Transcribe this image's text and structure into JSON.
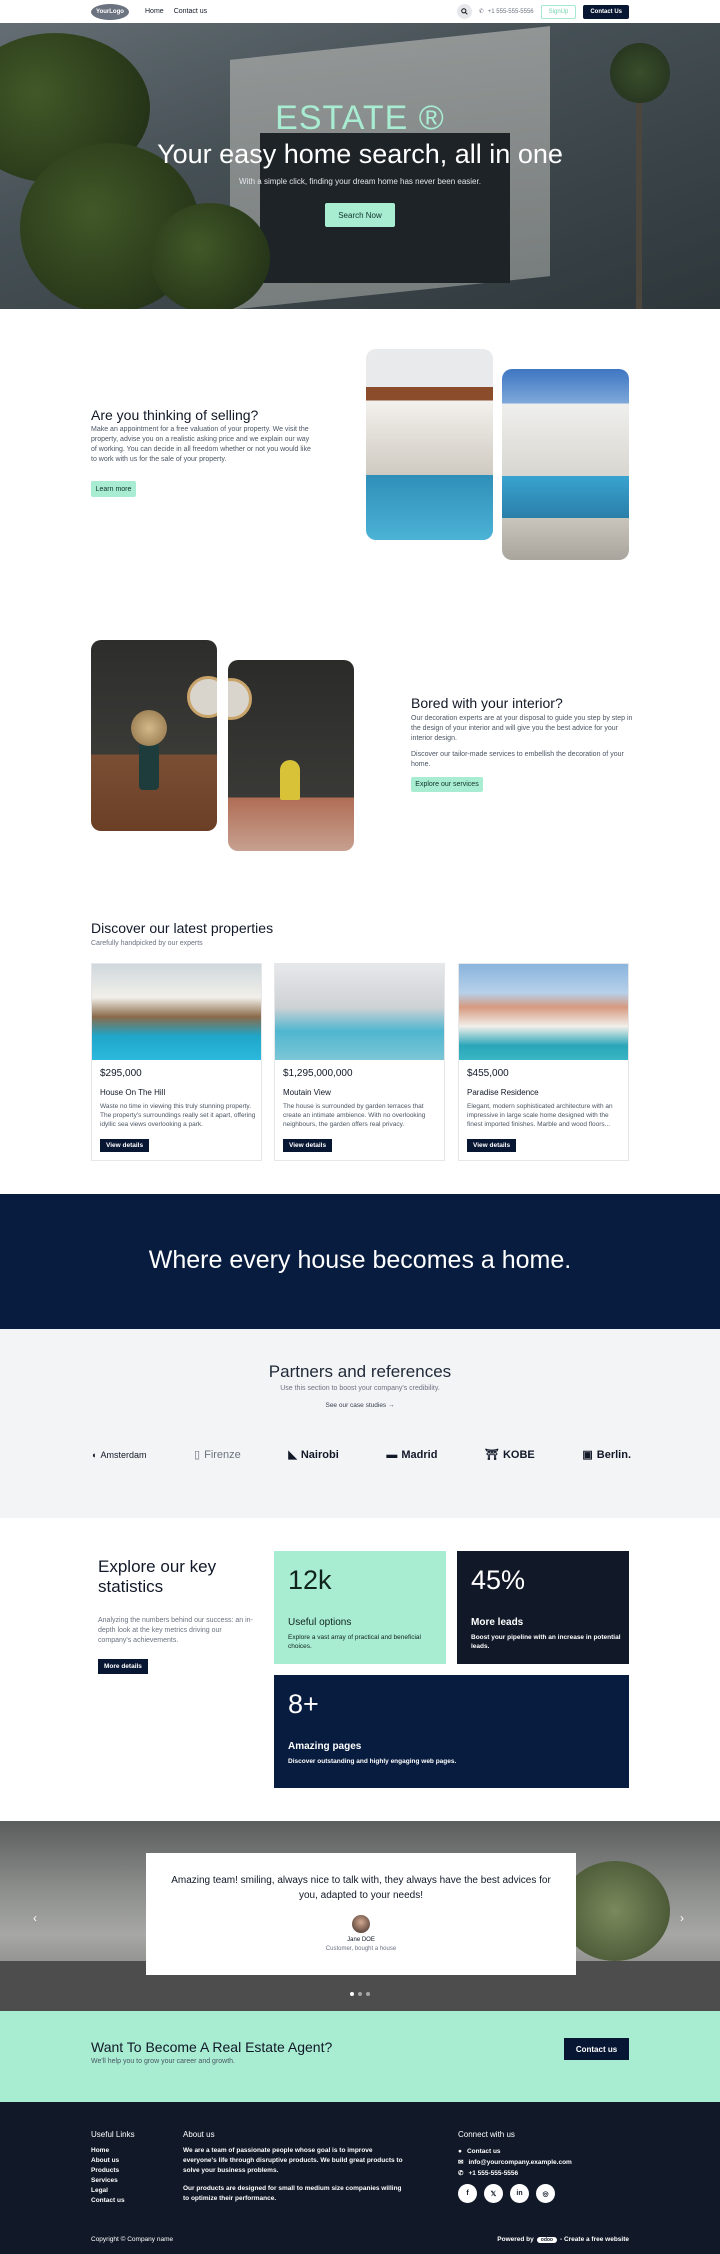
{
  "nav": {
    "logo": "YourLogo",
    "links": [
      "Home",
      "Contact us"
    ],
    "phone": "+1 555-555-5556",
    "signup": "SignUp",
    "contact": "Contact Us"
  },
  "hero": {
    "brand": "ESTATE ®",
    "title": "Your easy home search, all in one",
    "subtitle": "With a simple click, finding your dream home has never been easier.",
    "button": "Search Now"
  },
  "sell": {
    "title": "Are you thinking of selling?",
    "text": "Make an appointment for a free valuation of your property. We visit the property, advise you on a realistic asking price and we explain our way of working. You can decide in all freedom whether or not you would like to work with us for the sale of your property.",
    "button": "Learn more"
  },
  "interior": {
    "title": "Bored with your interior?",
    "text1": "Our decoration experts are at your disposal to guide you step by step in the design of your interior and will give you the best advice for your interior design.",
    "text2": "Discover our tailor-made services to embellish the decoration of your home.",
    "button": "Explore our services"
  },
  "properties": {
    "title": "Discover our latest properties",
    "subtitle": "Carefully handpicked by our experts",
    "button": "View details",
    "items": [
      {
        "price": "$295,000",
        "name": "House On The Hill",
        "desc": "Waste no time in viewing this truly stunning property. The property's surroundings really set it apart, offering idyllic sea views overlooking a park."
      },
      {
        "price": "$1,295,000,000",
        "name": "Moutain View",
        "desc": "The house is surrounded by garden terraces that create an intimate ambience. With no overlooking neighbours, the garden offers real privacy."
      },
      {
        "price": "$455,000",
        "name": "Paradise Residence",
        "desc": "Elegant, modern sophisticated architecture with an impressive in large scale home designed with the finest imported finishes. Marble and wood floors..."
      }
    ]
  },
  "banner": {
    "text": "Where every house becomes a home."
  },
  "partners": {
    "title": "Partners and references",
    "subtitle": "Use this section to boost your company's credibility.",
    "link": "See our case studies  →",
    "logos": [
      "Amsterdam",
      "Firenze",
      "Nairobi",
      "Madrid",
      "KOBE",
      "Berlin."
    ]
  },
  "stats": {
    "title": "Explore our key statistics",
    "text": "Analyzing the numbers behind our success: an in-depth look at the key metrics driving our company's achievements.",
    "button": "More details",
    "items": [
      {
        "value": "12k",
        "label": "Useful options",
        "text": "Explore a vast array of practical and beneficial choices."
      },
      {
        "value": "45%",
        "label": "More leads",
        "text": "Boost your pipeline with an increase in potential leads."
      },
      {
        "value": "8+",
        "label": "Amazing pages",
        "text": "Discover outstanding and highly engaging web pages."
      }
    ]
  },
  "testimonial": {
    "quote": "Amazing team! smiling, always nice to talk with, they always have the best advices for you, adapted to your needs!",
    "name": "Jane DOE",
    "role": "Customer, bought a house"
  },
  "cta": {
    "title": "Want To Become A Real Estate Agent?",
    "subtitle": "We'll help you to grow your career and growth.",
    "button": "Contact us"
  },
  "footer": {
    "useful_title": "Useful Links",
    "links": [
      "Home",
      "About us",
      "Products",
      "Services",
      "Legal",
      "Contact us"
    ],
    "about_title": "About us",
    "about1": "We are a team of passionate people whose goal is to improve everyone's life through disruptive products. We build great products to solve your business problems.",
    "about2": "Our products are designed for small to medium size companies willing to optimize their performance.",
    "connect_title": "Connect with us",
    "contact_link": "Contact us",
    "email": "info@yourcompany.example.com",
    "phone": "+1 555-555-5556",
    "copyright": "Copyright © Company name",
    "powered_pre": "Powered by",
    "powered_badge": "odoo",
    "powered_post": "- Create a free website"
  }
}
